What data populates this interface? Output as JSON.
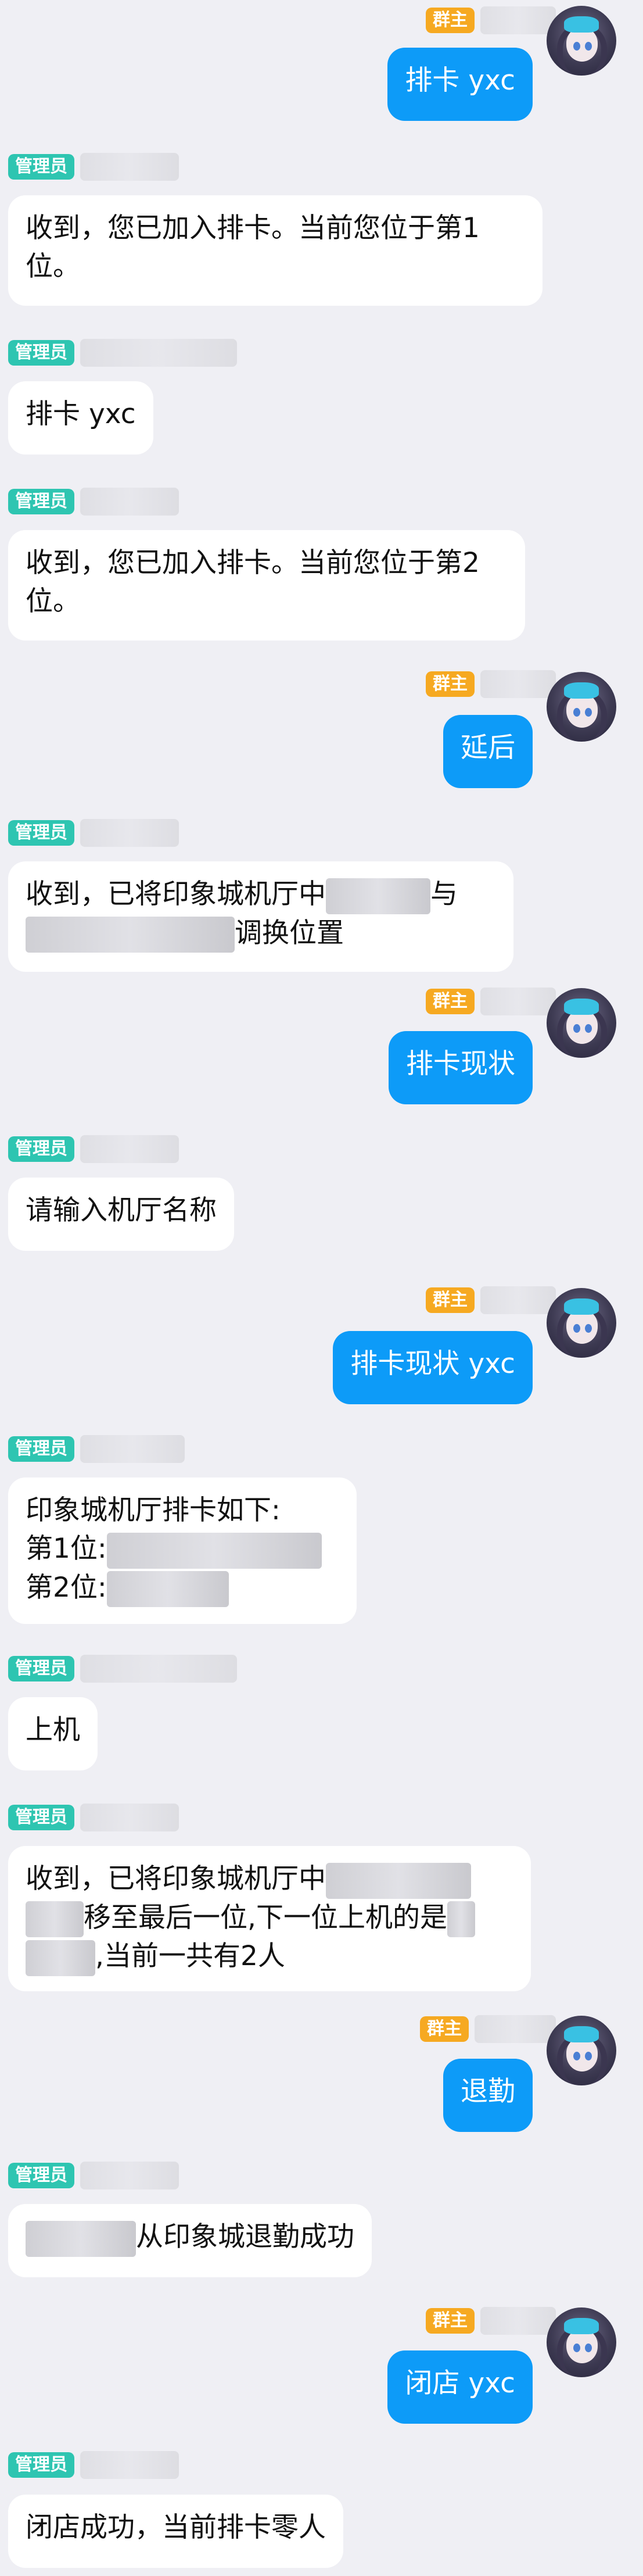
{
  "roles": {
    "admin": "管理员",
    "owner": "群主"
  },
  "messages": [
    {
      "text": "排卡 yxc"
    },
    {
      "text": "收到，您已加入排卡。当前您位于第1位。"
    },
    {
      "text": "排卡 yxc"
    },
    {
      "text": "收到，您已加入排卡。当前您位于第2位。"
    },
    {
      "text": "延后"
    },
    {
      "line1": "收到，已将印象城机厅中",
      "line1_tail": "与",
      "line2": "调换位置"
    },
    {
      "text": "排卡现状"
    },
    {
      "text": "请输入机厅名称"
    },
    {
      "text": "排卡现状 yxc"
    },
    {
      "line1": "印象城机厅排卡如下:",
      "line2": "第1位:",
      "line3": "第2位:"
    },
    {
      "text": "上机"
    },
    {
      "line1": "收到，已将印象城机厅中",
      "line2": "移至最后一位,下一位上机的是",
      "line3": ",当前一共有2人"
    },
    {
      "text": "退勤"
    },
    {
      "text_tail": "从印象城退勤成功"
    },
    {
      "text": "闭店 yxc"
    },
    {
      "text": "闭店成功，当前排卡零人"
    }
  ]
}
